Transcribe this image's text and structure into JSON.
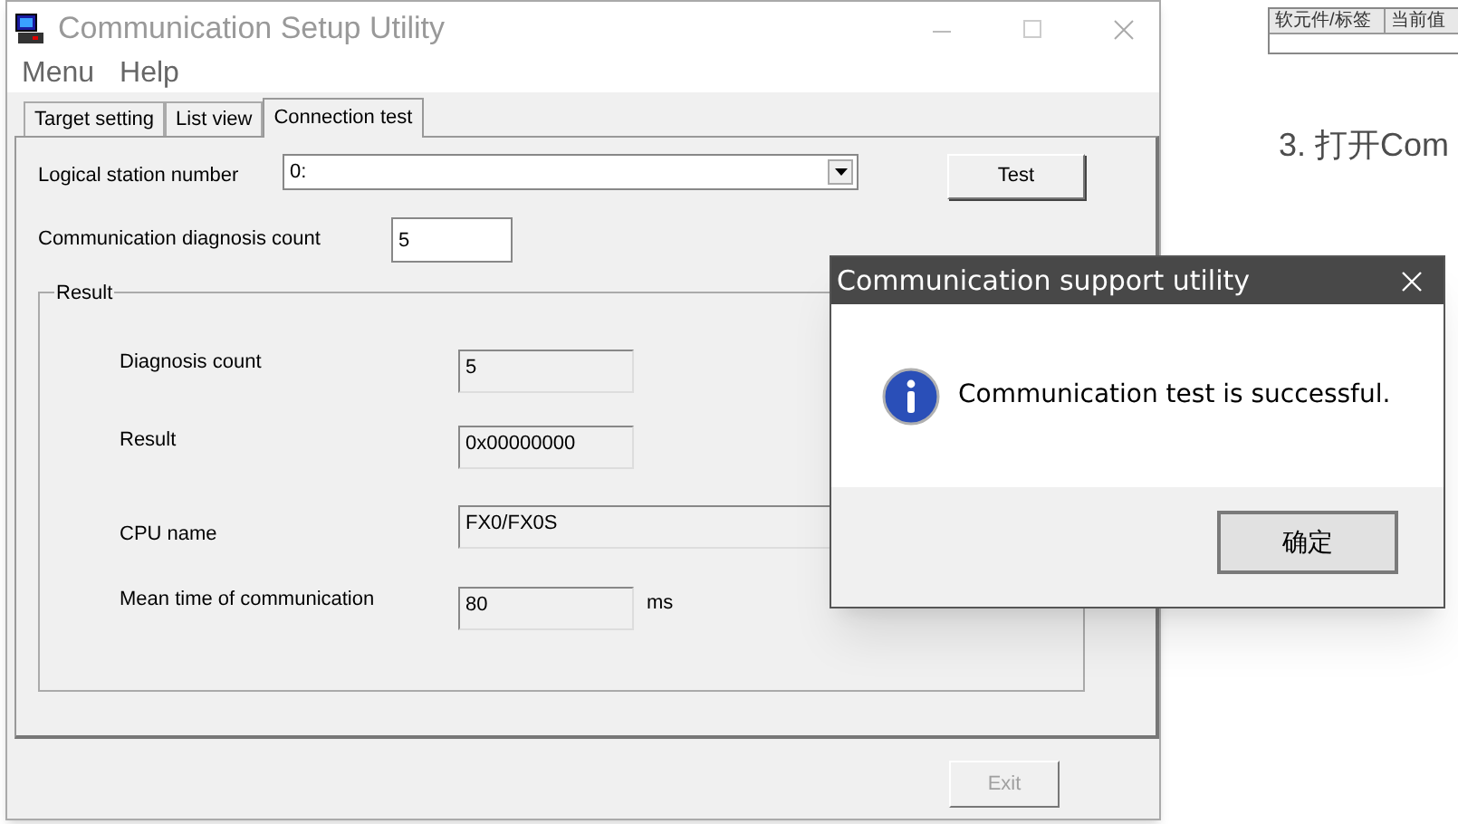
{
  "background_page": {
    "table_columns": [
      "软元件/标签",
      "当前值"
    ],
    "heading": "3. 打开Com"
  },
  "window": {
    "title": "Communication Setup Utility"
  },
  "menu": [
    "Menu",
    "Help"
  ],
  "tabs": [
    {
      "label": "Target setting",
      "selected": false
    },
    {
      "label": "List view",
      "selected": false
    },
    {
      "label": "Connection test",
      "selected": true
    }
  ],
  "connection_test": {
    "logical_station_number": {
      "label": "Logical station number",
      "value": "0:"
    },
    "test_button": "Test",
    "diagnosis_count": {
      "label": "Communication diagnosis count",
      "value": "5"
    },
    "result": {
      "title": "Result",
      "fields": [
        {
          "label": "Diagnosis count",
          "value": "5",
          "wide": false
        },
        {
          "label": "Result",
          "value": "0x00000000",
          "wide": false
        },
        {
          "label": "CPU name",
          "value": "FX0/FX0S",
          "wide": true
        },
        {
          "label": "Mean time of communication",
          "value": "80",
          "wide": false,
          "unit": "ms"
        }
      ]
    }
  },
  "exit_button": {
    "label": "Exit",
    "disabled": true
  },
  "message_box": {
    "title": "Communication support utility",
    "message": "Communication test is successful.",
    "button": "确定"
  }
}
